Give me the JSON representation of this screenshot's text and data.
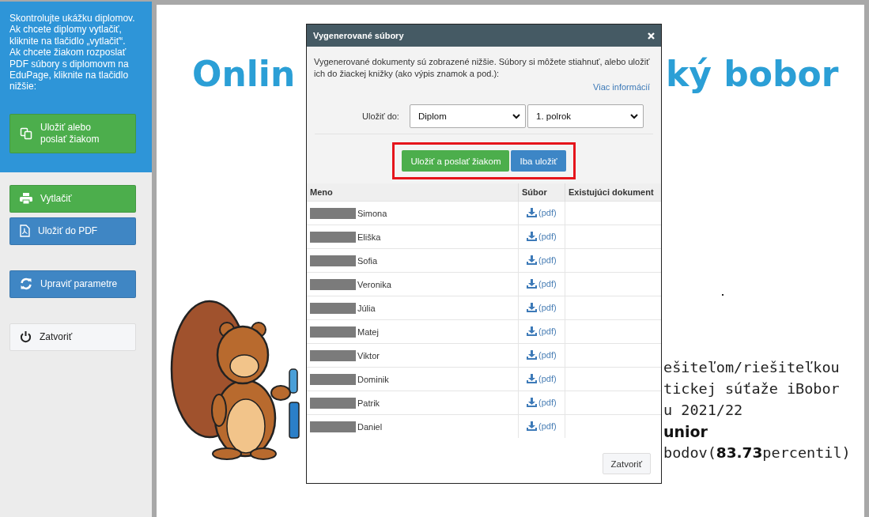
{
  "sidebar": {
    "intro": "Skontrolujte ukážku diplomov. Ak chcete diplomy vytlačiť, kliknite na tlačidlo „vytlačiť“. Ak chcete žiakom rozposlať PDF súbory s diplomovm na EduPage, kliknite na tlačidlo nižšie:",
    "primary": {
      "label": "Uložiť alebo poslať žiakom",
      "kind": "send"
    },
    "buttons": [
      {
        "label": "Vytlačiť",
        "kind": "print"
      },
      {
        "label": "Uložiť do PDF",
        "kind": "pdf"
      },
      {
        "label": "Upraviť parametre",
        "kind": "params"
      },
      {
        "label": "Zatvoriť",
        "kind": "close"
      }
    ]
  },
  "diploma": {
    "title_left": "Onlin",
    "title_right": "ký bobor",
    "lines": [
      "ešiteľom/riešiteľkou",
      "tickej súťaže iBobor",
      "u 2021/22",
      "unior",
      "bodov(**83.73**percentil)"
    ]
  },
  "dialog": {
    "title": "Vygenerované súbory",
    "intro": "Vygenerované dokumenty sú zobrazené nižšie. Súbory si môžete stiahnuť, alebo uložiť ich do žiackej knižky (ako výpis znamok a pod.):",
    "more_link": "Viac informácií",
    "save_label": "Uložiť do:",
    "selects": [
      {
        "value": "Diplom"
      },
      {
        "value": "1. polrok"
      }
    ],
    "actions": [
      {
        "label": "Uložiť a poslať žiakom",
        "kind": "success"
      },
      {
        "label": "Iba uložiť",
        "kind": "primary"
      }
    ],
    "columns": [
      "Meno",
      "Súbor",
      "Existujúci dokument"
    ],
    "rows": [
      {
        "name": "Simona",
        "file": "(pdf)"
      },
      {
        "name": "Eliška",
        "file": "(pdf)"
      },
      {
        "name": "Sofia",
        "file": "(pdf)"
      },
      {
        "name": "Veronika",
        "file": "(pdf)"
      },
      {
        "name": "Júlia",
        "file": "(pdf)"
      },
      {
        "name": "Matej",
        "file": "(pdf)"
      },
      {
        "name": "Viktor",
        "file": "(pdf)"
      },
      {
        "name": "Dominik",
        "file": "(pdf)"
      },
      {
        "name": "Patrik",
        "file": "(pdf)"
      },
      {
        "name": "Daniel",
        "file": "(pdf)"
      }
    ],
    "close_button": "Zatvoriť"
  }
}
